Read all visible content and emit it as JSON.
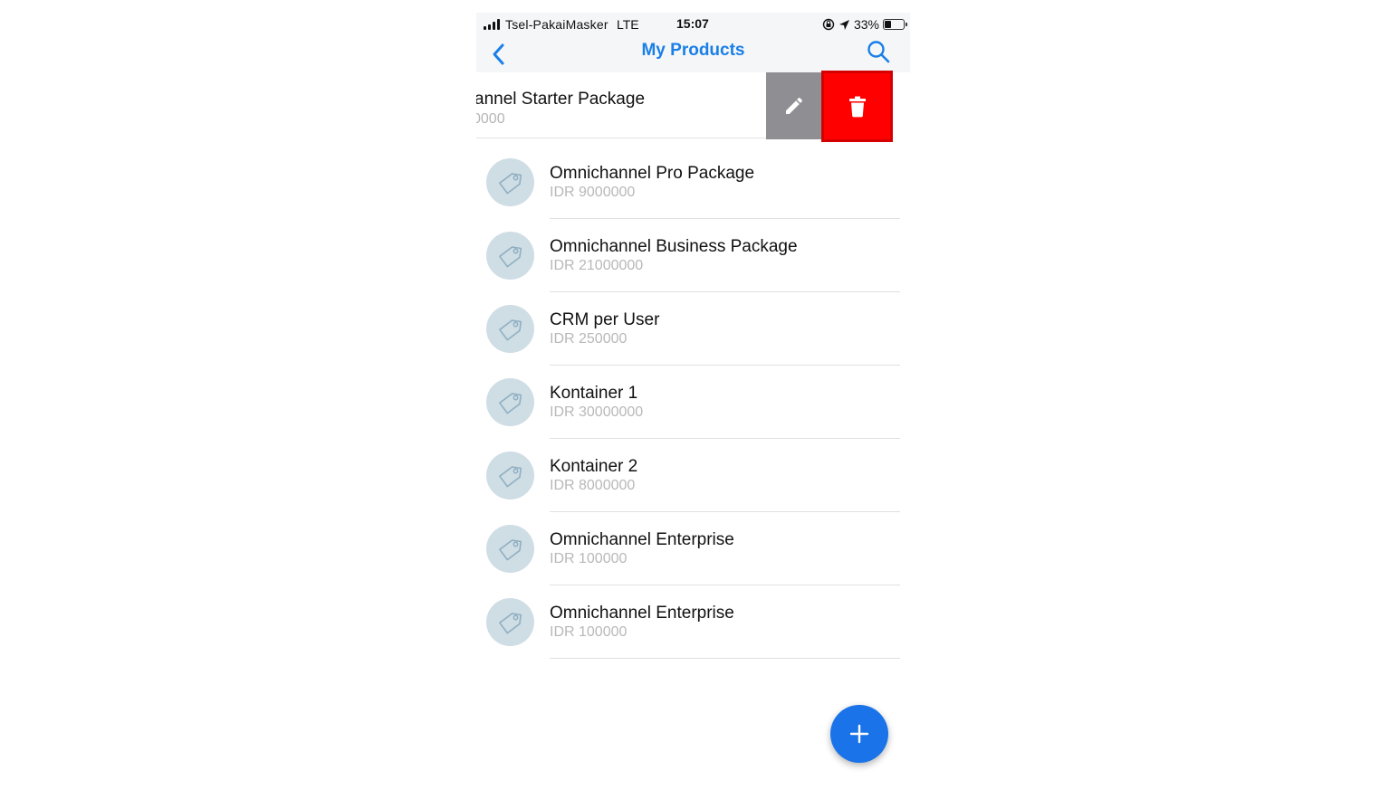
{
  "status_bar": {
    "carrier": "Tsel-PakaiMasker",
    "network": "LTE",
    "time": "15:07",
    "battery_percent": "33%",
    "battery_level": 0.33,
    "icons": [
      "signal-icon",
      "rotation-lock-icon",
      "location-arrow-icon",
      "battery-icon"
    ]
  },
  "navbar": {
    "title": "My Products",
    "back_icon": "chevron-left-icon",
    "search_icon": "search-icon"
  },
  "swiped_item": {
    "title": "annel Starter Package",
    "price": "0000",
    "actions": {
      "edit_icon": "pencil-icon",
      "delete_icon": "trash-icon"
    }
  },
  "products": [
    {
      "title": "Omnichannel Pro Package",
      "price": "IDR 9000000"
    },
    {
      "title": "Omnichannel Business Package",
      "price": "IDR 21000000"
    },
    {
      "title": "CRM per User",
      "price": "IDR 250000"
    },
    {
      "title": "Kontainer 1",
      "price": "IDR 30000000"
    },
    {
      "title": "Kontainer 2",
      "price": "IDR 8000000"
    },
    {
      "title": "Omnichannel Enterprise",
      "price": "IDR 100000"
    },
    {
      "title": "Omnichannel Enterprise",
      "price": "IDR 100000"
    }
  ],
  "fab": {
    "icon": "plus-icon"
  },
  "colors": {
    "accent": "#1a7fe6",
    "fab": "#1a73e8",
    "delete": "#ff0000",
    "edit": "#8e8e93",
    "avatar_bg": "#cfdde5",
    "tag_icon": "#8fb0c2"
  }
}
